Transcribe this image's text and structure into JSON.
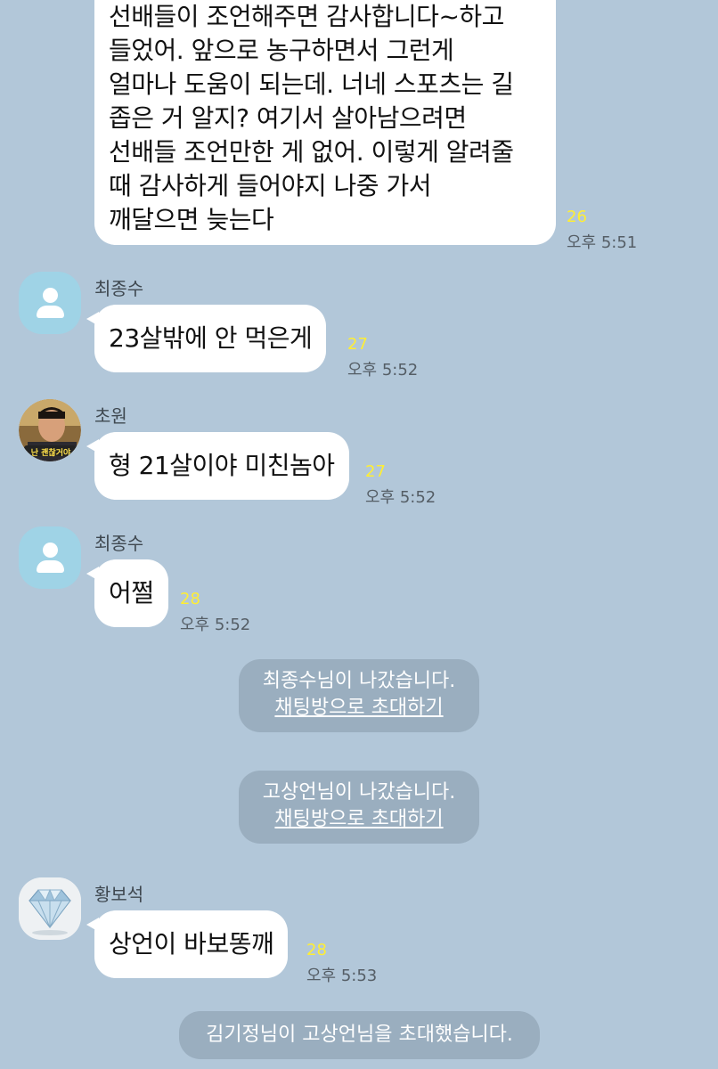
{
  "messages": [
    {
      "lines": [
        "선배들이 조언해주면 감사합니다~하고",
        "들었어. 앞으로 농구하면서 그런게",
        "얼마나 도움이 되는데. 너네 스포츠는 길",
        "좁은 거 알지? 여기서 살아남으려면",
        "선배들 조언만한 게 없어. 이렇게 알려줄",
        "때 감사하게 들어야지 나중 가서",
        "깨달으면 늦는다"
      ],
      "unread": "26",
      "time": "오후 5:51"
    },
    {
      "sender": "최종수",
      "text": "23살밖에 안 먹은게",
      "unread": "27",
      "time": "오후 5:52"
    },
    {
      "sender": "초원",
      "text": "형 21살이야 미친놈아",
      "unread": "27",
      "time": "오후 5:52",
      "avatar_caption": "난 괜찮거야"
    },
    {
      "sender": "최종수",
      "text": "어쩔",
      "unread": "28",
      "time": "오후 5:52"
    },
    {
      "sender": "황보석",
      "text": "상언이 바보똥깨",
      "unread": "28",
      "time": "오후 5:53"
    }
  ],
  "system": [
    {
      "text": "최종수님이 나갔습니다.",
      "link": "채팅방으로 초대하기"
    },
    {
      "text": "고상언님이 나갔습니다.",
      "link": "채팅방으로 초대하기"
    },
    {
      "text": "김기정님이 고상언님을 초대했습니다."
    }
  ],
  "colors": {
    "background": "#b2c7d9",
    "bubble": "#ffffff",
    "unread": "#ffee33",
    "system_bubble": "#9aaebf"
  }
}
